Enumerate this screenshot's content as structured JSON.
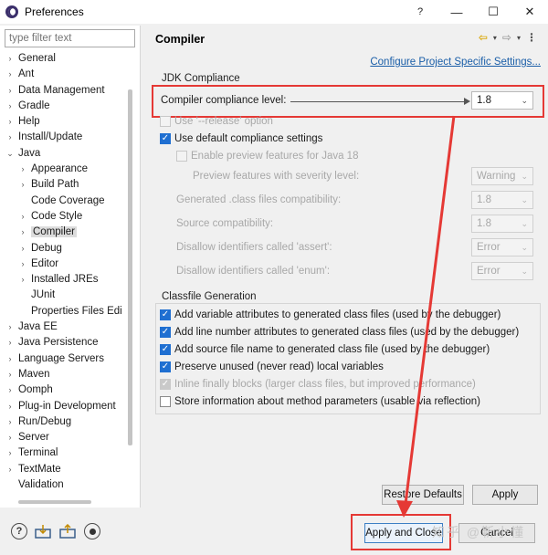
{
  "window": {
    "title": "Preferences",
    "help_glyph": "?",
    "min_glyph": "—",
    "max_glyph": "☐",
    "close_glyph": "✕"
  },
  "filter": {
    "placeholder": "type filter text"
  },
  "tree": [
    {
      "label": "General",
      "level": 0,
      "twisty": "›"
    },
    {
      "label": "Ant",
      "level": 0,
      "twisty": "›"
    },
    {
      "label": "Data Management",
      "level": 0,
      "twisty": "›"
    },
    {
      "label": "Gradle",
      "level": 0,
      "twisty": "›"
    },
    {
      "label": "Help",
      "level": 0,
      "twisty": "›"
    },
    {
      "label": "Install/Update",
      "level": 0,
      "twisty": "›"
    },
    {
      "label": "Java",
      "level": 0,
      "twisty": "⌄"
    },
    {
      "label": "Appearance",
      "level": 1,
      "twisty": "›"
    },
    {
      "label": "Build Path",
      "level": 1,
      "twisty": "›"
    },
    {
      "label": "Code Coverage",
      "level": 1,
      "twisty": ""
    },
    {
      "label": "Code Style",
      "level": 1,
      "twisty": "›"
    },
    {
      "label": "Compiler",
      "level": 1,
      "twisty": "›",
      "selected": true
    },
    {
      "label": "Debug",
      "level": 1,
      "twisty": "›"
    },
    {
      "label": "Editor",
      "level": 1,
      "twisty": "›"
    },
    {
      "label": "Installed JREs",
      "level": 1,
      "twisty": "›"
    },
    {
      "label": "JUnit",
      "level": 1,
      "twisty": ""
    },
    {
      "label": "Properties Files Edi",
      "level": 1,
      "twisty": ""
    },
    {
      "label": "Java EE",
      "level": 0,
      "twisty": "›"
    },
    {
      "label": "Java Persistence",
      "level": 0,
      "twisty": "›"
    },
    {
      "label": "Language Servers",
      "level": 0,
      "twisty": "›"
    },
    {
      "label": "Maven",
      "level": 0,
      "twisty": "›"
    },
    {
      "label": "Oomph",
      "level": 0,
      "twisty": "›"
    },
    {
      "label": "Plug-in Development",
      "level": 0,
      "twisty": "›"
    },
    {
      "label": "Run/Debug",
      "level": 0,
      "twisty": "›"
    },
    {
      "label": "Server",
      "level": 0,
      "twisty": "›"
    },
    {
      "label": "Terminal",
      "level": 0,
      "twisty": "›"
    },
    {
      "label": "TextMate",
      "level": 0,
      "twisty": "›"
    },
    {
      "label": "Validation",
      "level": 0,
      "twisty": ""
    }
  ],
  "page": {
    "title": "Compiler",
    "nav": {
      "back": "⇦",
      "forward": "⇨",
      "caret": "▾",
      "menu": "⋮"
    },
    "link": "Configure Project Specific Settings...",
    "jdk": {
      "group": "JDK Compliance",
      "compliance_label": "Compiler compliance level:",
      "compliance_value": "1.8",
      "release_option": "Use '--release' option",
      "use_default": "Use default compliance settings",
      "enable_preview": "Enable preview features for Java 18",
      "preview_severity_label": "Preview features with severity level:",
      "preview_severity_value": "Warning",
      "generated_label": "Generated .class files compatibility:",
      "generated_value": "1.8",
      "source_label": "Source compatibility:",
      "source_value": "1.8",
      "assert_label": "Disallow identifiers called 'assert':",
      "assert_value": "Error",
      "enum_label": "Disallow identifiers called 'enum':",
      "enum_value": "Error"
    },
    "classfile": {
      "group": "Classfile Generation",
      "items": [
        "Add variable attributes to generated class files (used by the debugger)",
        "Add line number attributes to generated class files (used by the debugger)",
        "Add source file name to generated class file (used by the debugger)",
        "Preserve unused (never read) local variables",
        "Inline finally blocks (larger class files, but improved performance)",
        "Store information about method parameters (usable via reflection)"
      ]
    },
    "restore_defaults": "Restore Defaults",
    "apply": "Apply"
  },
  "footer": {
    "apply_close": "Apply and Close",
    "cancel": "Cancel",
    "help_icon": "?",
    "watermark": "知乎 @靳小懂"
  },
  "colors": {
    "highlight": "#e53935",
    "checkbox": "#1f6fd1",
    "link": "#1a5ea8"
  }
}
